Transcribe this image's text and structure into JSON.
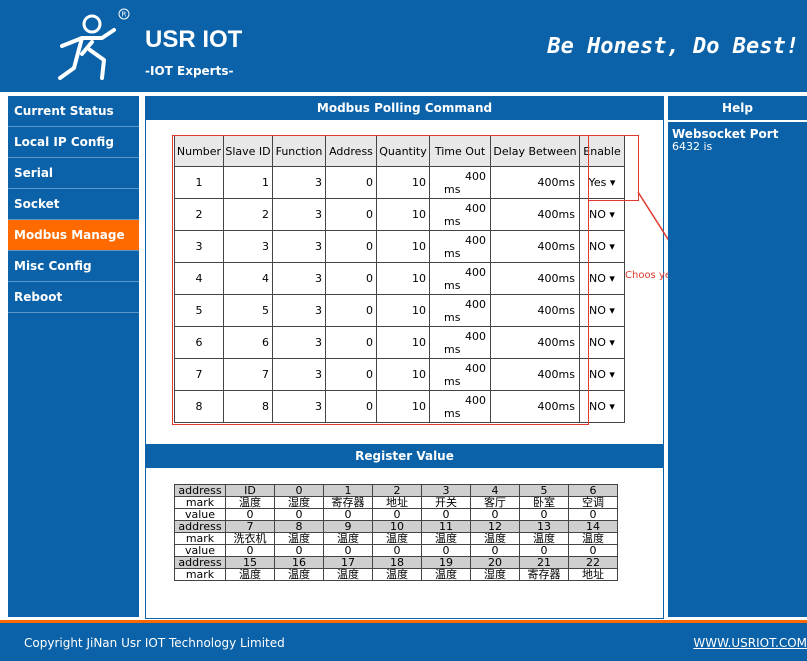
{
  "header": {
    "brand": "USR IOT",
    "brand_sub": "-IOT Experts-",
    "slogan": "Be Honest, Do Best!"
  },
  "nav": {
    "items": [
      {
        "label": "Current Status",
        "active": false
      },
      {
        "label": "Local IP Config",
        "active": false
      },
      {
        "label": "Serial",
        "active": false
      },
      {
        "label": "Socket",
        "active": false
      },
      {
        "label": "Modbus Manage",
        "active": true
      },
      {
        "label": "Misc Config",
        "active": false
      },
      {
        "label": "Reboot",
        "active": false
      }
    ]
  },
  "polling": {
    "title": "Modbus Polling Command",
    "headers": [
      "Number",
      "Slave ID",
      "Function",
      "Address",
      "Quantity",
      "Time Out",
      "Delay Between",
      "Enable"
    ],
    "timeout_unit": "ms",
    "delay_unit": "ms",
    "rows": [
      {
        "number": "1",
        "slave": "1",
        "function": "3",
        "address": "0",
        "quantity": "10",
        "timeout": "400",
        "delay": "400",
        "enable": "Yes"
      },
      {
        "number": "2",
        "slave": "2",
        "function": "3",
        "address": "0",
        "quantity": "10",
        "timeout": "400",
        "delay": "400",
        "enable": "NO"
      },
      {
        "number": "3",
        "slave": "3",
        "function": "3",
        "address": "0",
        "quantity": "10",
        "timeout": "400",
        "delay": "400",
        "enable": "NO"
      },
      {
        "number": "4",
        "slave": "4",
        "function": "3",
        "address": "0",
        "quantity": "10",
        "timeout": "400",
        "delay": "400",
        "enable": "NO"
      },
      {
        "number": "5",
        "slave": "5",
        "function": "3",
        "address": "0",
        "quantity": "10",
        "timeout": "400",
        "delay": "400",
        "enable": "NO"
      },
      {
        "number": "6",
        "slave": "6",
        "function": "3",
        "address": "0",
        "quantity": "10",
        "timeout": "400",
        "delay": "400",
        "enable": "NO"
      },
      {
        "number": "7",
        "slave": "7",
        "function": "3",
        "address": "0",
        "quantity": "10",
        "timeout": "400",
        "delay": "400",
        "enable": "NO"
      },
      {
        "number": "8",
        "slave": "8",
        "function": "3",
        "address": "0",
        "quantity": "10",
        "timeout": "400",
        "delay": "400",
        "enable": "NO"
      }
    ]
  },
  "annotation": "Choos yes to open function",
  "register": {
    "title": "Register Value",
    "blocks": [
      {
        "address": [
          "address",
          "ID",
          "0",
          "1",
          "2",
          "3",
          "4",
          "5",
          "6"
        ],
        "mark": [
          "mark",
          "温度",
          "湿度",
          "寄存器",
          "地址",
          "开关",
          "客厅",
          "卧室",
          "空调"
        ],
        "value": [
          "value",
          "0",
          "0",
          "0",
          "0",
          "0",
          "0",
          "0",
          "0"
        ]
      },
      {
        "address": [
          "address",
          "7",
          "8",
          "9",
          "10",
          "11",
          "12",
          "13",
          "14"
        ],
        "mark": [
          "mark",
          "洗衣机",
          "温度",
          "温度",
          "温度",
          "温度",
          "温度",
          "温度",
          "温度"
        ],
        "value": [
          "value",
          "0",
          "0",
          "0",
          "0",
          "0",
          "0",
          "0",
          "0"
        ]
      },
      {
        "address": [
          "address",
          "15",
          "16",
          "17",
          "18",
          "19",
          "20",
          "21",
          "22"
        ],
        "mark": [
          "mark",
          "温度",
          "温度",
          "温度",
          "温度",
          "温度",
          "湿度",
          "寄存器",
          "地址"
        ]
      }
    ]
  },
  "help": {
    "title": "Help",
    "heading": "Websocket Port",
    "text": "6432 is"
  },
  "footer": {
    "copyright": "Copyright JiNan Usr IOT Technology Limited",
    "site": "WWW.USRIOT.COM"
  },
  "colors": {
    "primary": "#0b62a8",
    "accent": "#ff6a00",
    "annotation": "#e0392f"
  }
}
